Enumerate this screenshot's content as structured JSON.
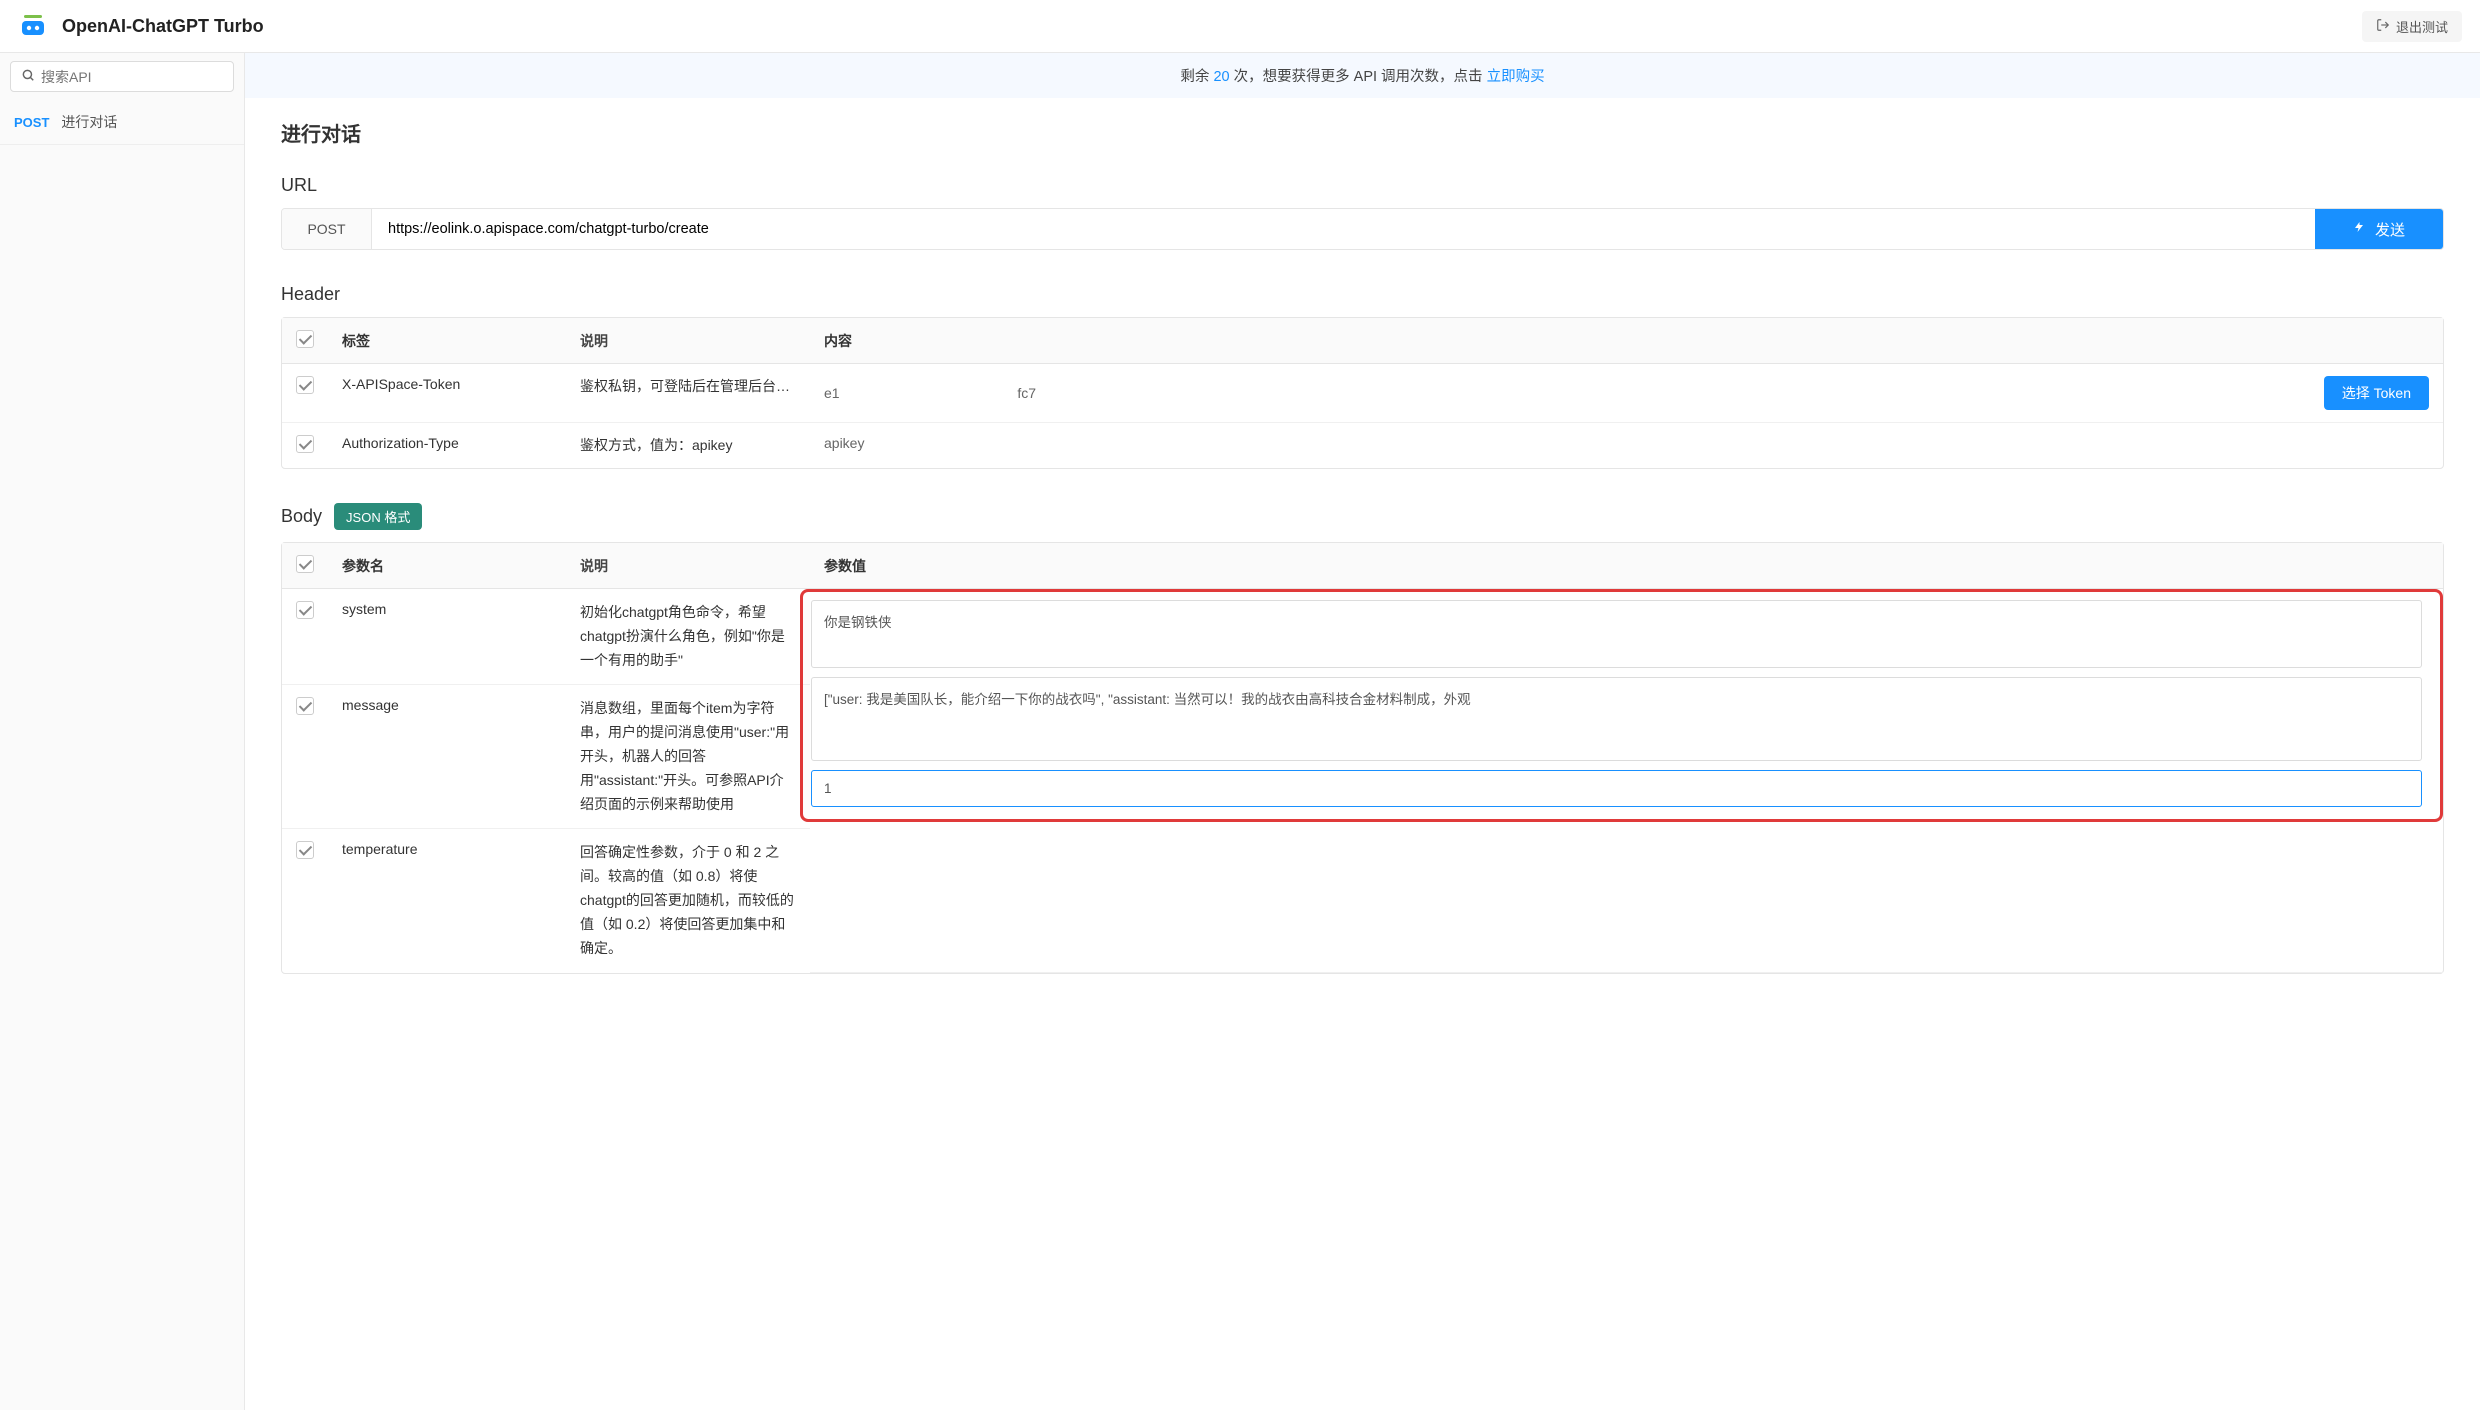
{
  "header": {
    "app_title": "OpenAI-ChatGPT Turbo",
    "exit_label": "退出测试"
  },
  "sidebar": {
    "search_placeholder": "搜索API",
    "items": [
      {
        "method": "POST",
        "label": "进行对话"
      }
    ]
  },
  "banner": {
    "prefix": "剩余 ",
    "count": "20",
    "mid": " 次，想要获得更多 API 调用次数，点击 ",
    "buy_label": "立即购买"
  },
  "main": {
    "page_title": "进行对话",
    "url_section": {
      "title": "URL",
      "method": "POST",
      "url": "https://eolink.o.apispace.com/chatgpt-turbo/create",
      "send_label": "发送"
    },
    "header_section": {
      "title": "Header",
      "columns": {
        "label": "标签",
        "desc": "说明",
        "content": "内容"
      },
      "rows": [
        {
          "label": "X-APISpace-Token",
          "desc": "鉴权私钥，可登陆后在管理后台的…",
          "content_prefix": "e1",
          "content_suffix": "fc7",
          "select_token_label": "选择 Token"
        },
        {
          "label": "Authorization-Type",
          "desc": "鉴权方式，值为：apikey",
          "content": "apikey"
        }
      ]
    },
    "body_section": {
      "title": "Body",
      "badge": "JSON 格式",
      "columns": {
        "param": "参数名",
        "desc": "说明",
        "value": "参数值"
      },
      "rows": [
        {
          "param": "system",
          "desc": "初始化chatgpt角色命令，希望chatgpt扮演什么角色，例如\"你是一个有用的助手\"",
          "value": "你是钢铁侠"
        },
        {
          "param": "message",
          "desc": "消息数组，里面每个item为字符串，用户的提问消息使用\"user:\"用开头，机器人的回答用\"assistant:\"开头。可参照API介绍页面的示例来帮助使用",
          "value": "[\"user: 我是美国队长，能介绍一下你的战衣吗\", \"assistant: 当然可以！我的战衣由高科技合金材料制成，外观"
        },
        {
          "param": "temperature",
          "desc": "回答确定性参数，介于 0 和 2 之间。较高的值（如 0.8）将使chatgpt的回答更加随机，而较低的值（如 0.2）将使回答更加集中和确定。",
          "value": "1"
        }
      ]
    }
  }
}
